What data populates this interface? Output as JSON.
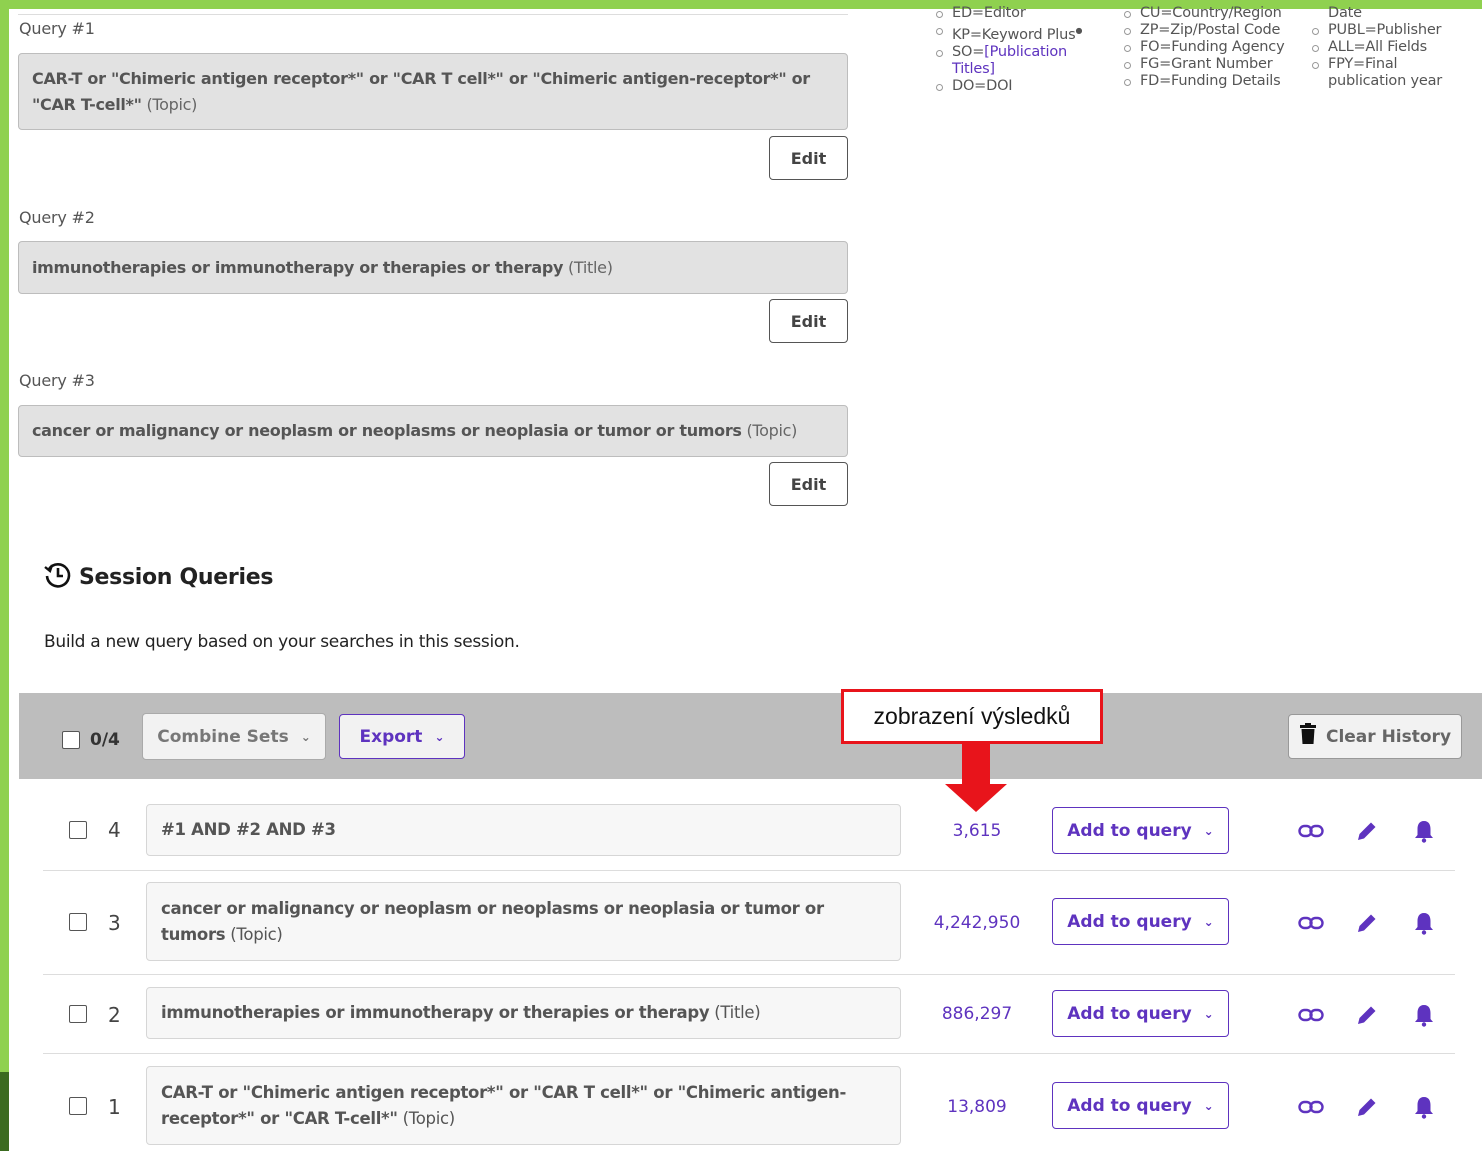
{
  "queries": [
    {
      "label": "Query #1",
      "text": "CAR-T or \"Chimeric antigen receptor*\" or \"CAR T cell*\" or \"Chimeric antigen-receptor*\" or \"CAR T-cell*\"",
      "field": "(Topic)",
      "edit_label": "Edit"
    },
    {
      "label": "Query #2",
      "text": "immunotherapies or immunotherapy or therapies or therapy",
      "field": "(Title)",
      "edit_label": "Edit"
    },
    {
      "label": "Query #3",
      "text": "cancer or malignancy or neoplasm or neoplasms or neoplasia or tumor or tumors",
      "field": "(Topic)",
      "edit_label": "Edit"
    }
  ],
  "field_tags": {
    "col1": [
      "ED=Editor",
      "KP=Keyword Plus",
      "SO=",
      "[Publication Titles]",
      "DO=DOI"
    ],
    "col2": [
      "CU=Country/Region",
      "ZP=Zip/Postal Code",
      "FO=Funding Agency",
      "FG=Grant Number",
      "FD=Funding Details"
    ],
    "col3": [
      "Date",
      "PUBL=Publisher",
      "ALL=All Fields",
      "FPY=Final publication year"
    ]
  },
  "session": {
    "title": "Session Queries",
    "description": "Build a new query based on your searches in this session.",
    "selected_count": "0/4",
    "combine_label": "Combine Sets",
    "export_label": "Export",
    "clear_label": "Clear History",
    "annotation": "zobrazení výsledků",
    "accent_color": "#5e33bf",
    "annotation_color": "#e8141b",
    "rows": [
      {
        "num": "4",
        "text": "#1 AND #2 AND #3",
        "field": "",
        "count": "3,615",
        "add_label": "Add to query"
      },
      {
        "num": "3",
        "text": "cancer or malignancy or neoplasm or neoplasms or neoplasia or tumor or tumors",
        "field": "(Topic)",
        "count": "4,242,950",
        "add_label": "Add to query"
      },
      {
        "num": "2",
        "text": "immunotherapies or immunotherapy or therapies or therapy",
        "field": "(Title)",
        "count": "886,297",
        "add_label": "Add to query"
      },
      {
        "num": "1",
        "text": "CAR-T or \"Chimeric antigen receptor*\" or \"CAR T cell*\" or \"Chimeric antigen-receptor*\" or \"CAR T-cell*\"",
        "field": "(Topic)",
        "count": "13,809",
        "add_label": "Add to query"
      }
    ],
    "row_icons": [
      "link-icon",
      "pencil-icon",
      "bell-icon"
    ]
  }
}
